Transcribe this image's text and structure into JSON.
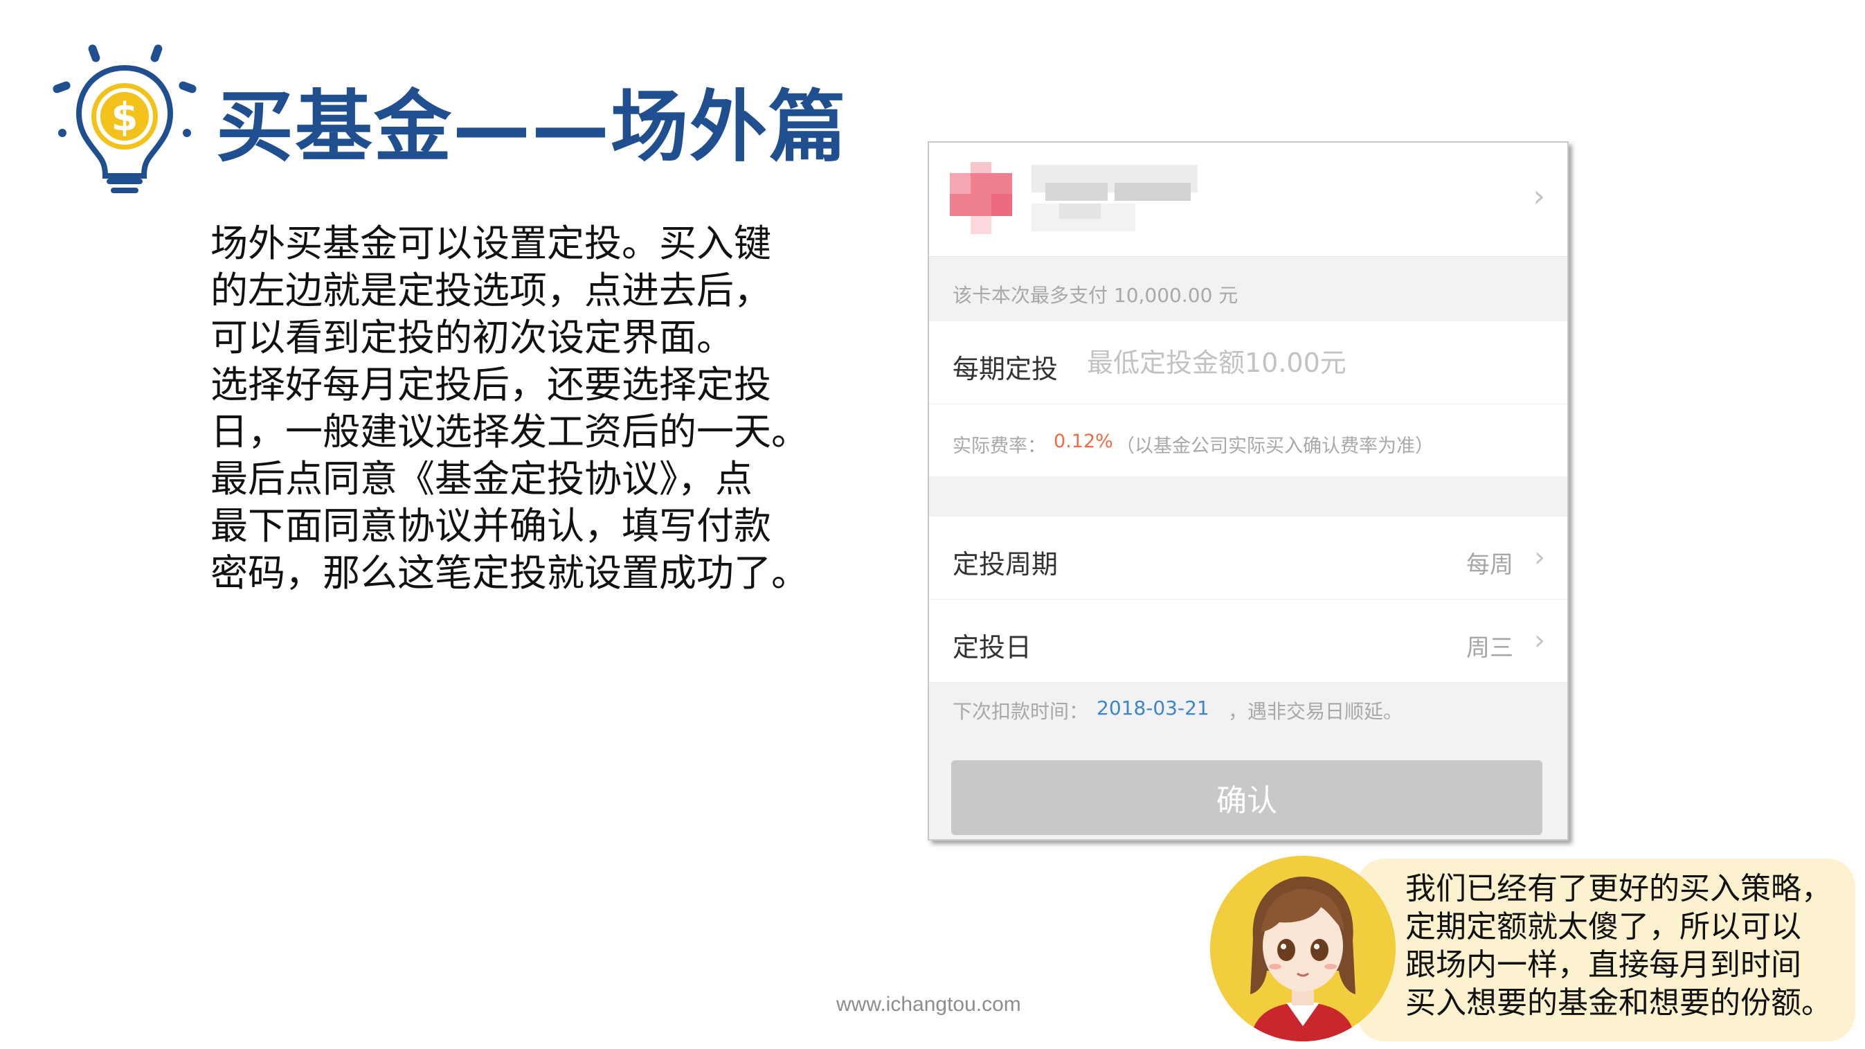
{
  "slide": {
    "title": "买基金——场外篇",
    "body_lines": [
      "场外买基金可以设置定投。买入键",
      "的左边就是定投选项，点进去后，",
      "可以看到定投的初次设定界面。",
      "选择好每月定投后，还要选择定投",
      "日，一般建议选择发工资后的一天。",
      "最后点同意《基金定投协议》，点",
      "最下面同意协议并确认，填写付款",
      "密码，那么这笔定投就设置成功了。"
    ],
    "footer_url": "www.ichangtou.com",
    "icon": "lightbulb-dollar-icon"
  },
  "phone": {
    "card_limit": "该卡本次最多支付 10,000.00 元",
    "amount": {
      "label": "每期定投",
      "placeholder": "最低定投金额10.00元"
    },
    "fee": {
      "label": "实际费率：",
      "value": "0.12%",
      "note": "（以基金公司实际买入确认费率为准）"
    },
    "period": {
      "label": "定投周期",
      "value": "每周"
    },
    "day": {
      "label": "定投日",
      "value": "周三"
    },
    "next": {
      "label": "下次扣款时间：",
      "date": "2018-03-21",
      "note": "，遇非交易日顺延。"
    },
    "confirm_label": "确认"
  },
  "bubble": {
    "lines": [
      "我们已经有了更好的买入策略，",
      "定期定额就太傻了，所以可以",
      "跟场内一样，直接每月到时间",
      "买入想要的基金和想要的份额。"
    ]
  },
  "colors": {
    "title": "#1f4f8e",
    "fee_value": "#f06a45",
    "date": "#3a86c8",
    "bubble_bg": "#fdf2cf",
    "avatar_bg": "#f2cd3e",
    "bulb_yellow": "#f2c21b"
  }
}
